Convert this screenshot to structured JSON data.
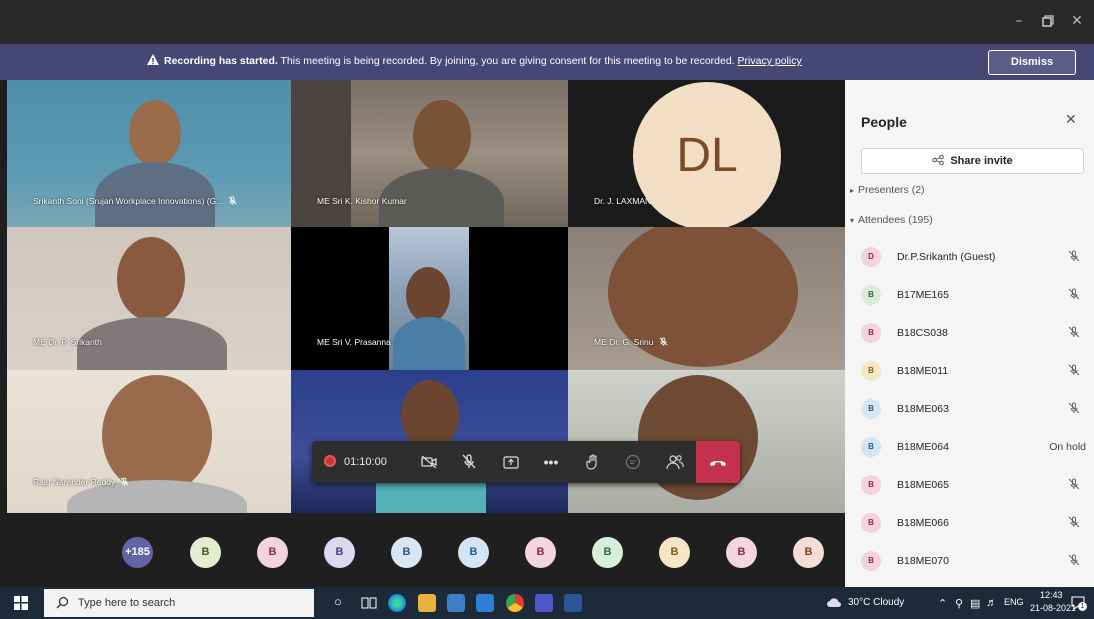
{
  "window": {
    "minimize_icon": "minimize-icon",
    "maximize_icon": "restore-icon",
    "close_icon": "close-icon"
  },
  "banner": {
    "bold": "Recording has started.",
    "text": " This meeting is being recorded. By joining, you are giving consent for this meeting to be recorded. ",
    "link": "Privacy policy",
    "dismiss": "Dismiss"
  },
  "tiles": [
    {
      "name": "Srikanth Soni (Srujan Workplace Innovations) (G...",
      "muted": true
    },
    {
      "name": "ME Sri K. Kishor Kumar",
      "muted": false
    },
    {
      "name": "Dr. J. LAXMAN (Guest)",
      "muted": true
    },
    {
      "name": "ME Dr. P. Srikanth",
      "muted": false
    },
    {
      "name": "ME Sri V. Prasanna",
      "muted": false
    },
    {
      "name": "ME Dr. G. Srinu",
      "muted": true
    },
    {
      "name": "Raju Narender Reddy",
      "muted": true
    }
  ],
  "dl_initials": "DL",
  "controls": {
    "timer": "01:10:00",
    "colors": {
      "leave": "#c4314b",
      "record": "#d13438"
    }
  },
  "strip": {
    "overflow": "+185",
    "chips": [
      "B",
      "B",
      "B",
      "B",
      "B",
      "B",
      "B",
      "B",
      "B",
      "B"
    ]
  },
  "people": {
    "title": "People",
    "share": "Share invite",
    "presenters": "Presenters (2)",
    "attendees": "Attendees (195)",
    "rows": [
      {
        "initial": "D",
        "name": "Dr.P.Srikanth (Guest)",
        "status": ""
      },
      {
        "initial": "B",
        "name": "B17ME165",
        "status": ""
      },
      {
        "initial": "B",
        "name": "B18CS038",
        "status": ""
      },
      {
        "initial": "B",
        "name": "B18ME011",
        "status": ""
      },
      {
        "initial": "B",
        "name": "B18ME063",
        "status": ""
      },
      {
        "initial": "B",
        "name": "B18ME064",
        "status": "On hold"
      },
      {
        "initial": "B",
        "name": "B18ME065",
        "status": ""
      },
      {
        "initial": "B",
        "name": "B18ME066",
        "status": ""
      },
      {
        "initial": "B",
        "name": "B18ME070",
        "status": ""
      }
    ]
  },
  "taskbar": {
    "search_placeholder": "Type here to search",
    "weather": "30°C  Cloudy",
    "lang": "ENG",
    "time": "12:43",
    "date": "21-08-2021",
    "notification_count": "1"
  }
}
